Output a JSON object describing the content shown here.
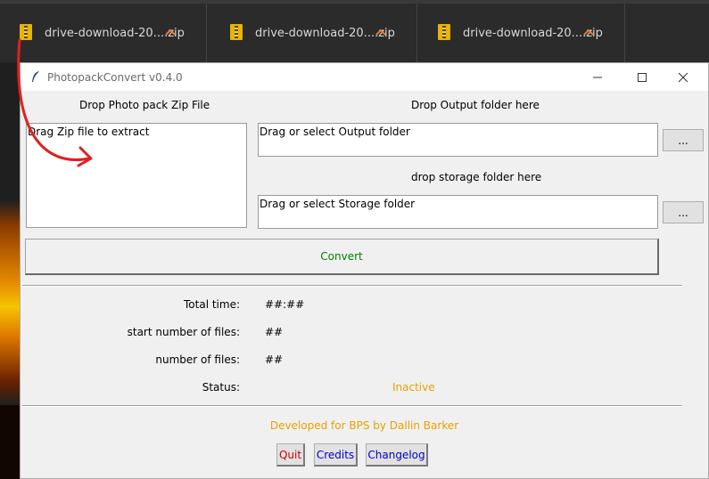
{
  "downloads": [
    {
      "name": "drive-download-20....zip",
      "file_icon": "zip-file-icon",
      "caret_icon": "chevron-up-icon"
    },
    {
      "name": "drive-download-20....zip",
      "file_icon": "zip-file-icon",
      "caret_icon": "chevron-up-icon"
    },
    {
      "name": "drive-download-20....zip",
      "file_icon": "zip-file-icon",
      "caret_icon": "chevron-up-icon"
    }
  ],
  "window": {
    "title": "PhotopackConvert v0.4.0",
    "icon": "feather-icon"
  },
  "zip_section": {
    "heading": "Drop Photo pack Zip File",
    "box_text": "Drag Zip file to extract"
  },
  "output_section": {
    "heading": "Drop Output folder here",
    "box_text": "Drag or select Output folder",
    "browse_label": "..."
  },
  "storage_section": {
    "heading": "drop storage folder here",
    "box_text": "Drag or select Storage folder",
    "browse_label": "..."
  },
  "convert_label": "Convert",
  "stats": {
    "total_time_label": "Total time:",
    "total_time_value": "##:##",
    "start_files_label": "start number of files:",
    "start_files_value": "##",
    "files_label": "number of files:",
    "files_value": "##",
    "status_label": "Status:",
    "status_value": "Inactive"
  },
  "footer": {
    "developer": "Developed for BPS by Dallin Barker",
    "quit": "Quit",
    "credits": "Credits",
    "changelog": "Changelog"
  },
  "colors": {
    "convert_text": "#008000",
    "status_text": "#e8a000",
    "quit_text": "#d00000",
    "link_text": "#0000c8",
    "annotation_arrow": "#e02020"
  }
}
